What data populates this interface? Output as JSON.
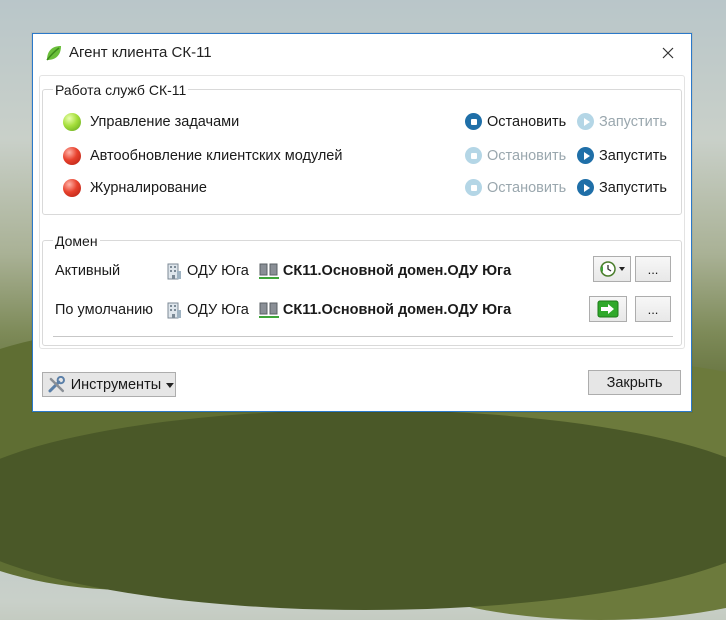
{
  "window": {
    "title": "Агент клиента СК-11"
  },
  "services": {
    "group_title": "Работа служб СК-11",
    "items": [
      {
        "label": "Управление задачами",
        "status": "running",
        "stop_label": "Остановить",
        "start_label": "Запустить"
      },
      {
        "label": "Автообновление клиентских модулей",
        "status": "stopped",
        "stop_label": "Остановить",
        "start_label": "Запустить"
      },
      {
        "label": "Журналирование",
        "status": "stopped",
        "stop_label": "Остановить",
        "start_label": "Запустить"
      }
    ]
  },
  "domain": {
    "group_title": "Домен",
    "active": {
      "label": "Активный",
      "site": "ОДУ Юга",
      "domain": "СК11.Основной домен.ОДУ Юга",
      "more_label": "..."
    },
    "default": {
      "label": "По умолчанию",
      "site": "ОДУ Юга",
      "domain": "СК11.Основной домен.ОДУ Юга",
      "more_label": "..."
    }
  },
  "footer": {
    "tools_label": "Инструменты",
    "close_label": "Закрыть"
  },
  "colors": {
    "accent": "#2b79c9",
    "running": "#7cc62a",
    "stopped": "#e03a27",
    "action": "#1f6fa8"
  }
}
